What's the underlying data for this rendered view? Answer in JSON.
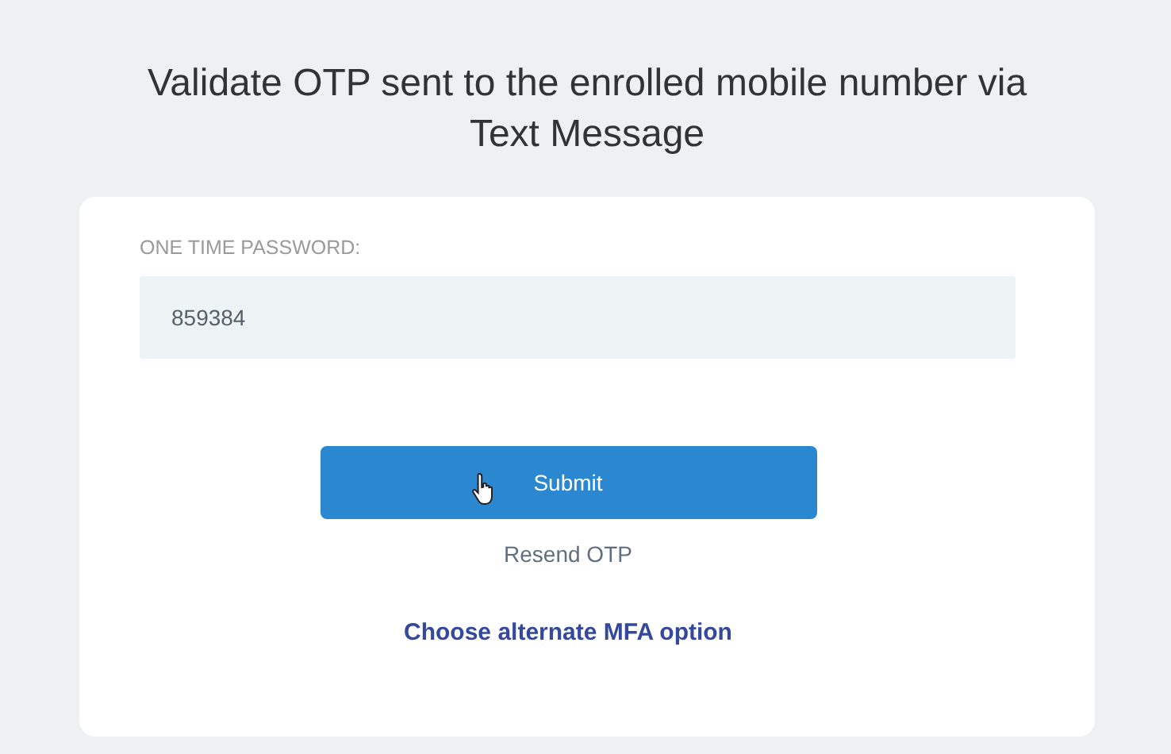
{
  "heading": "Validate OTP sent to the enrolled mobile number via Text Message",
  "otp_field": {
    "label": "ONE TIME PASSWORD:",
    "value": "859384"
  },
  "submit_button": {
    "label": "Submit"
  },
  "resend_link": "Resend OTP",
  "alternate_link": "Choose alternate MFA option"
}
